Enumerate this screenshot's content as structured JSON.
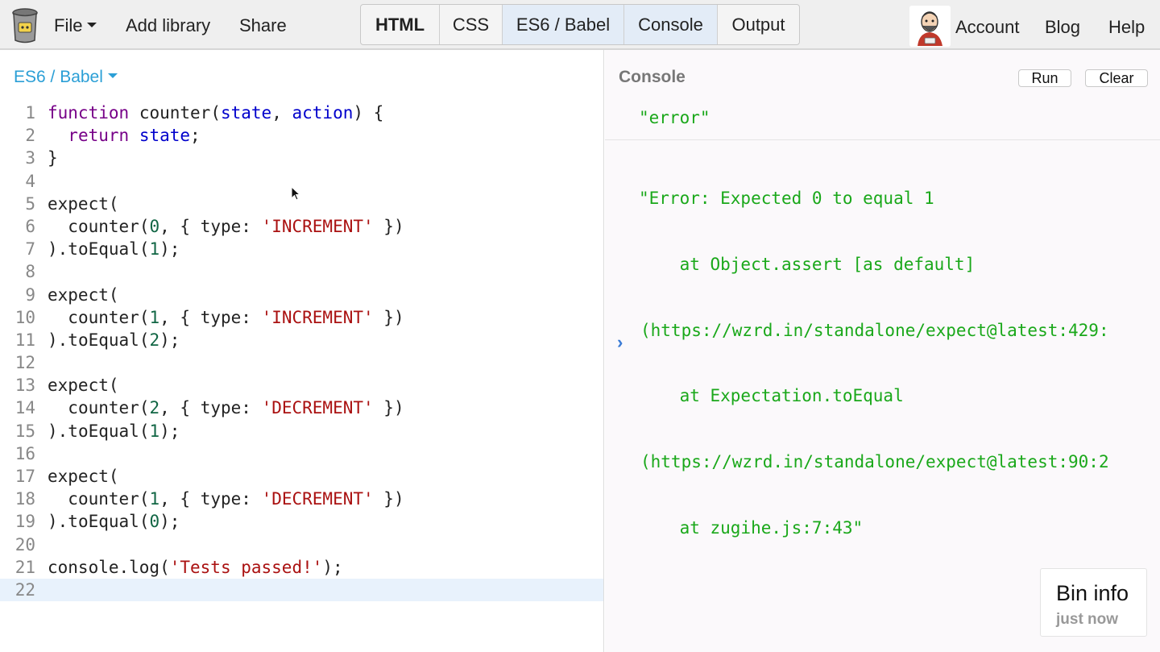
{
  "topbar": {
    "menu": {
      "file": "File",
      "add_library": "Add library",
      "share": "Share"
    },
    "panels": [
      {
        "label": "HTML",
        "active": false
      },
      {
        "label": "CSS",
        "active": false
      },
      {
        "label": "ES6 / Babel",
        "active": true
      },
      {
        "label": "Console",
        "active": true
      },
      {
        "label": "Output",
        "active": false
      }
    ],
    "account": "Account",
    "blog": "Blog",
    "help": "Help"
  },
  "editor": {
    "language": "ES6 / Babel",
    "current_line": 22,
    "line_numbers": [
      "1",
      "2",
      "3",
      "4",
      "5",
      "6",
      "7",
      "8",
      "9",
      "10",
      "11",
      "12",
      "13",
      "14",
      "15",
      "16",
      "17",
      "18",
      "19",
      "20",
      "21",
      "22"
    ],
    "tokens": {
      "function": "function",
      "counter": "counter",
      "state": "state",
      "action": "action",
      "return": "return",
      "expect": "expect",
      "type": "type",
      "increment": "'INCREMENT'",
      "decrement": "'DECREMENT'",
      "toEqual": "toEqual",
      "console_log": "console.log",
      "tests_passed": "'Tests passed!'",
      "n0": "0",
      "n1": "1",
      "n2": "2"
    }
  },
  "console": {
    "title": "Console",
    "run_label": "Run",
    "clear_label": "Clear",
    "logs": [
      [
        "\"error\""
      ],
      [
        "\"Error: Expected 0 to equal 1",
        "    at Object.assert [as default]",
        "(https://wzrd.in/standalone/expect@latest:429:",
        "    at Expectation.toEqual",
        "(https://wzrd.in/standalone/expect@latest:90:2",
        "    at zugihe.js:7:43\""
      ]
    ],
    "prompt_symbol": "›"
  },
  "bin_info": {
    "title": "Bin info",
    "subtitle": "just now"
  },
  "colors": {
    "accent": "#2b9fd6",
    "console_text": "#1aa81a",
    "keyword": "#770088",
    "variable": "#0000cc",
    "string": "#aa1111",
    "number": "#116644"
  }
}
